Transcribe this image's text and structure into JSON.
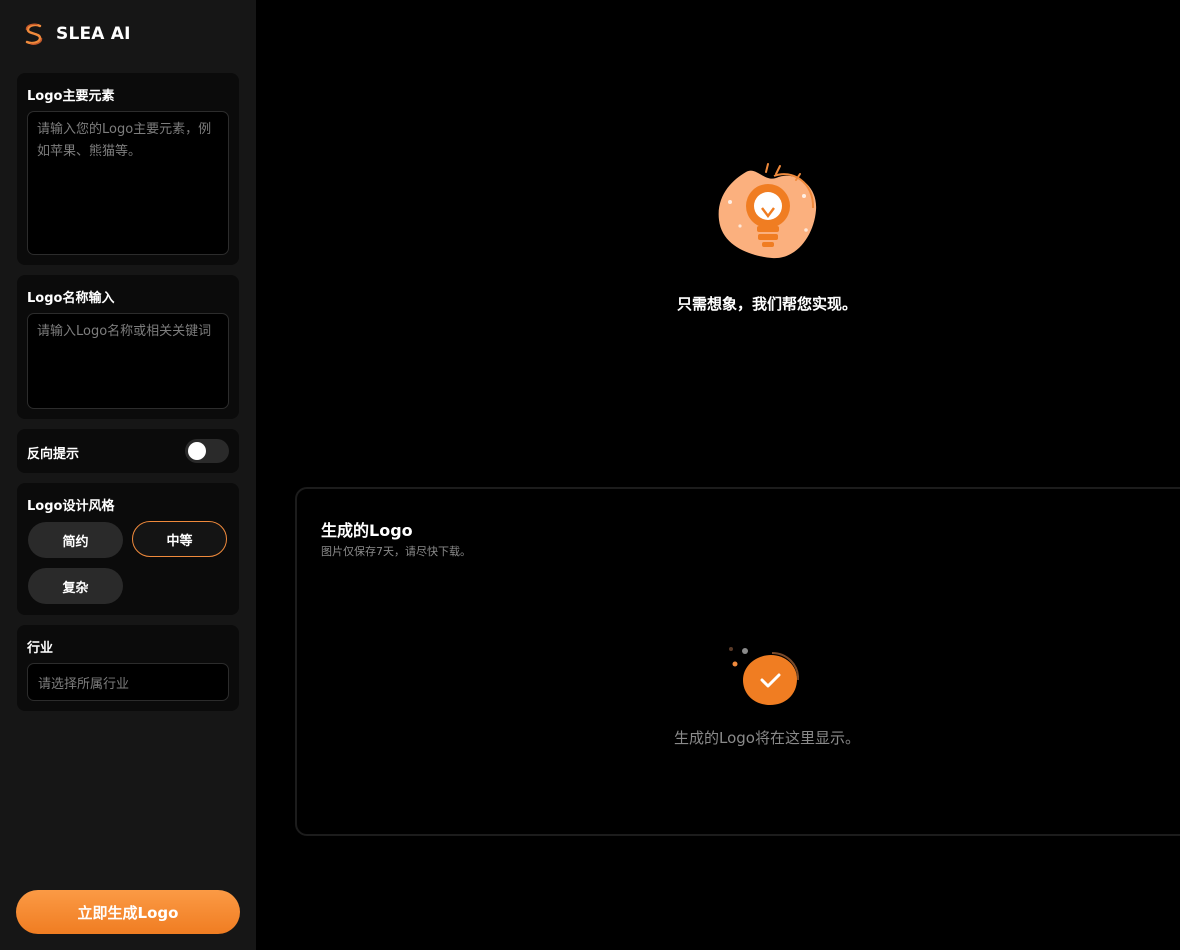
{
  "brand": {
    "name": "SLEA AI",
    "accent": "#f08a3c"
  },
  "sidebar": {
    "main_elements": {
      "title": "Logo主要元素",
      "placeholder": "请输入您的Logo主要元素，例如苹果、熊猫等。",
      "value": ""
    },
    "logo_name": {
      "title": "Logo名称输入",
      "placeholder": "请输入Logo名称或相关关键词",
      "value": ""
    },
    "reverse_prompt": {
      "title": "反向提示",
      "enabled": false
    },
    "design_style": {
      "title": "Logo设计风格",
      "options": [
        "简约",
        "中等",
        "复杂"
      ],
      "selected": "中等"
    },
    "industry": {
      "title": "行业",
      "placeholder": "请选择所属行业"
    },
    "generate_button": "立即生成Logo"
  },
  "main": {
    "hero_icon": "lightbulb-icon",
    "hero_text": "只需想象，我们帮您实现。",
    "result": {
      "title": "生成的Logo",
      "subtitle": "图片仅保存7天，请尽快下载。",
      "icon": "checkmark-badge-icon",
      "placeholder": "生成的Logo将在这里显示。"
    }
  }
}
